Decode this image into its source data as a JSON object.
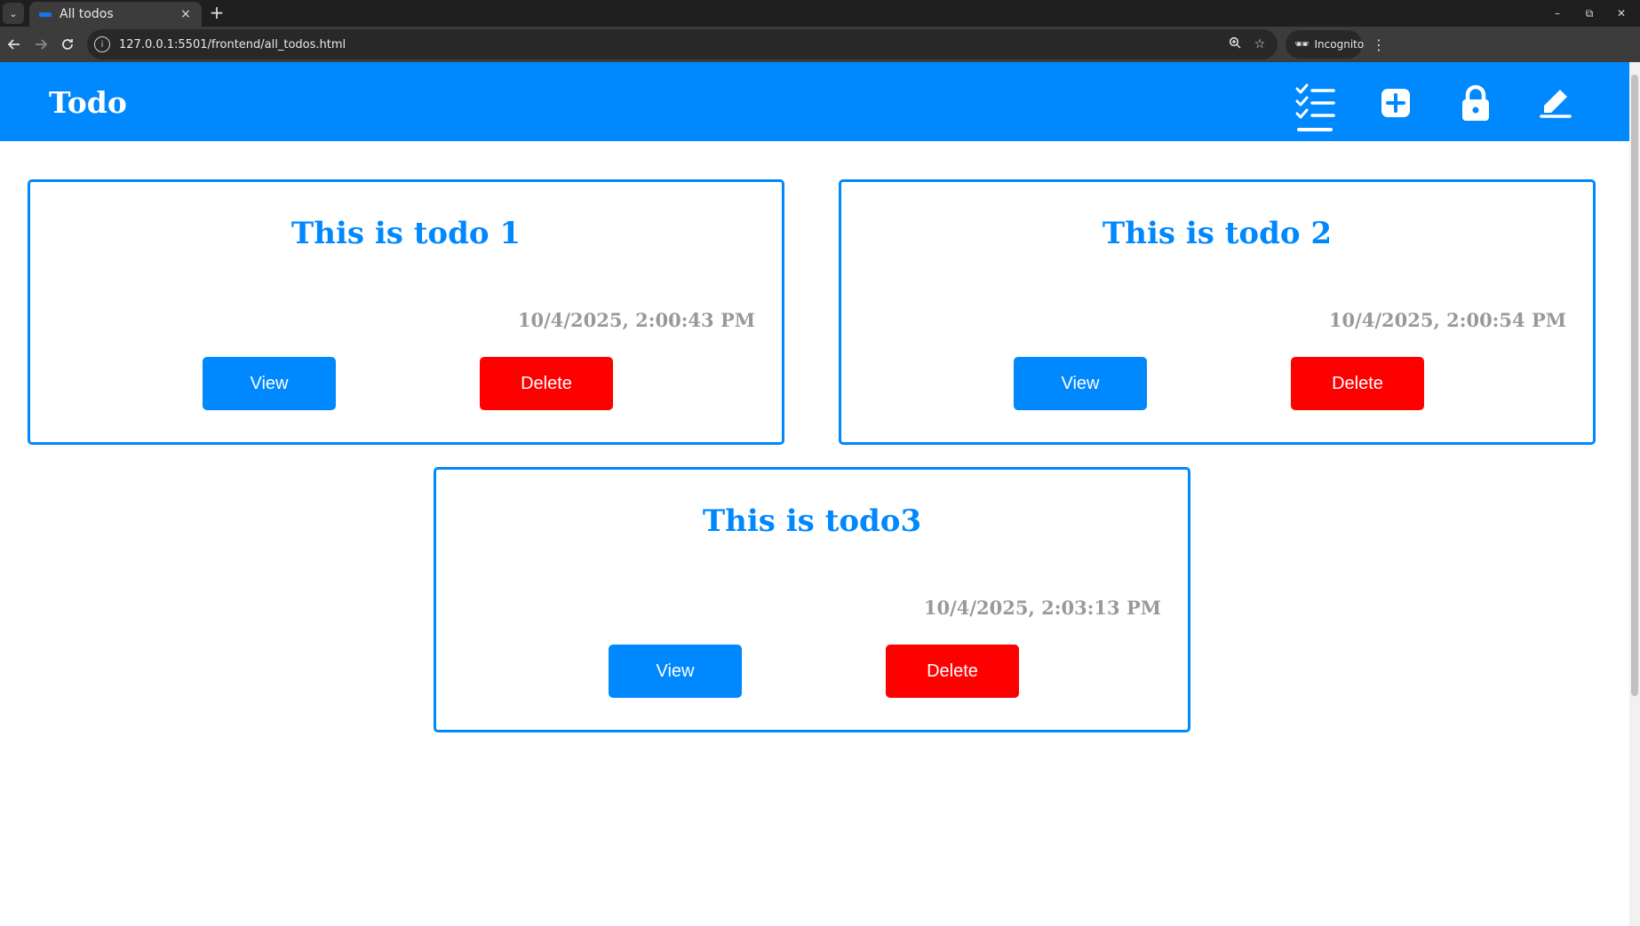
{
  "browser": {
    "tab_title": "All todos",
    "tab_close": "×",
    "new_tab": "+",
    "url": "127.0.0.1:5501/frontend/all_todos.html",
    "incognito_label": "Incognito",
    "controls": {
      "minimize": "–",
      "restore": "⧉",
      "close": "✕"
    }
  },
  "header": {
    "brand": "Todo",
    "nav": [
      {
        "icon": "checklist-icon",
        "active": true
      },
      {
        "icon": "plus-square-icon",
        "active": false
      },
      {
        "icon": "lock-icon",
        "active": false
      },
      {
        "icon": "pencil-icon",
        "active": false
      }
    ]
  },
  "todos": [
    {
      "title": "This is todo 1",
      "date": "10/4/2025, 2:00:43 PM",
      "view_label": "View",
      "delete_label": "Delete"
    },
    {
      "title": "This is todo 2",
      "date": "10/4/2025, 2:00:54 PM",
      "view_label": "View",
      "delete_label": "Delete"
    },
    {
      "title": "This is todo3",
      "date": "10/4/2025, 2:03:13 PM",
      "view_label": "View",
      "delete_label": "Delete"
    }
  ],
  "colors": {
    "primary": "#0088ff",
    "danger": "#ff0000",
    "date_text": "#999999"
  }
}
